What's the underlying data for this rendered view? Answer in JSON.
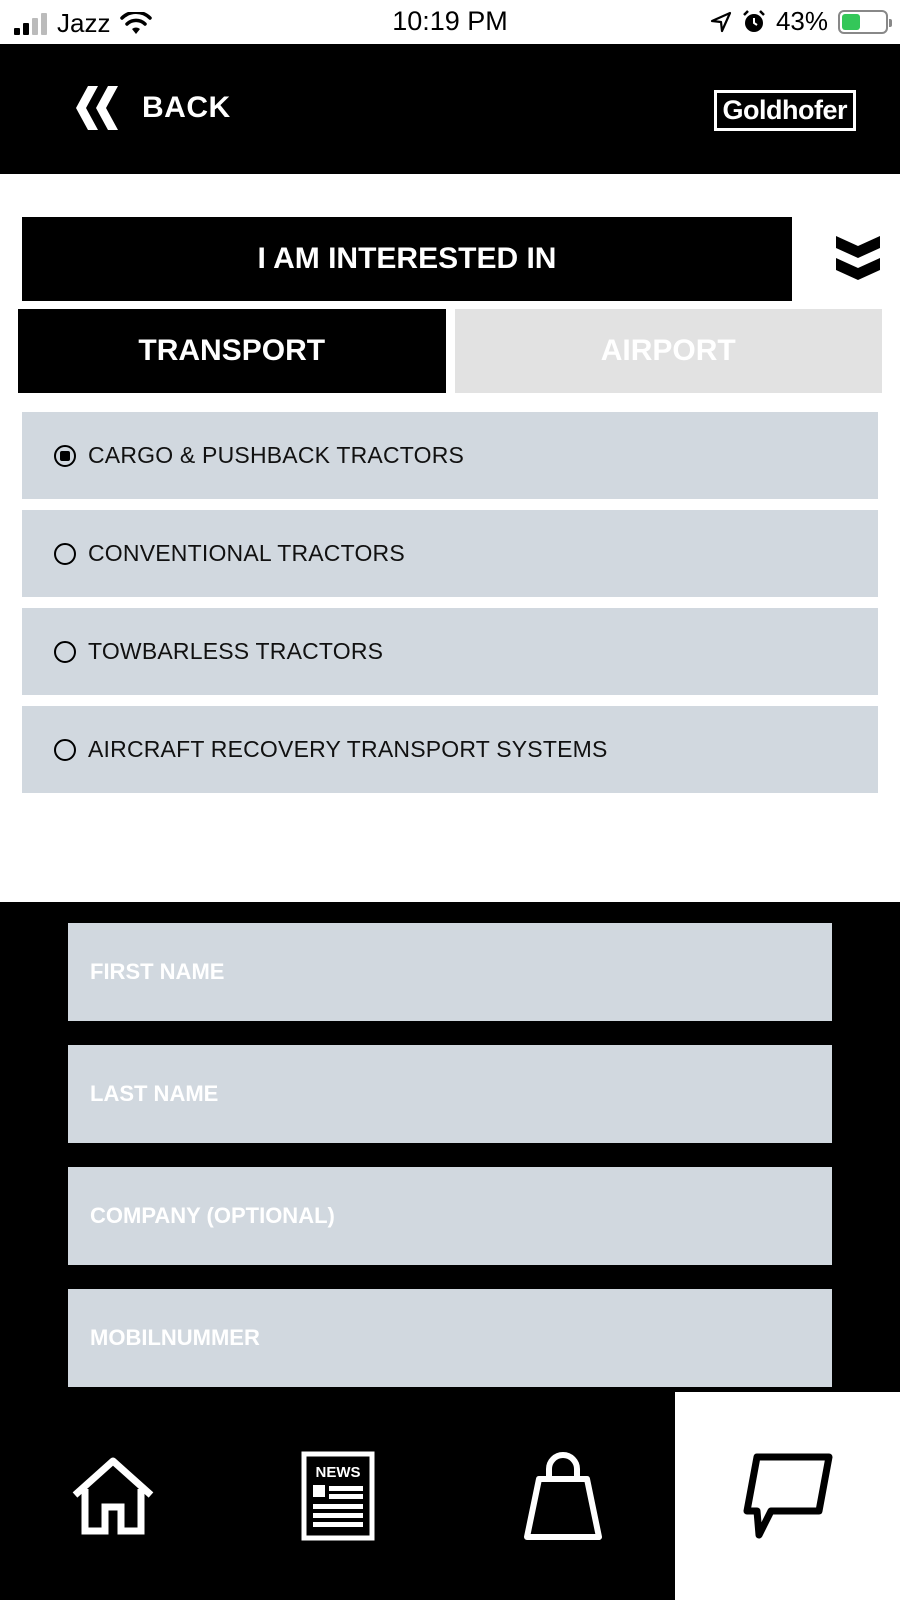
{
  "status_bar": {
    "carrier": "Jazz",
    "time": "10:19 PM",
    "battery_percent": "43%",
    "battery_level": 0.43,
    "battery_color": "#34c759"
  },
  "header": {
    "back_label": "BACK",
    "logo_text": "Goldhofer",
    "back_icon": "double-chevron-left-icon"
  },
  "interested": {
    "title": "I AM INTERESTED IN",
    "toggle_icon": "double-chevron-down-icon"
  },
  "tabs": [
    {
      "label": "TRANSPORT",
      "active": true
    },
    {
      "label": "AIRPORT",
      "active": false
    }
  ],
  "options": [
    {
      "label": "CARGO & PUSHBACK TRACTORS",
      "selected": true
    },
    {
      "label": "CONVENTIONAL TRACTORS",
      "selected": false
    },
    {
      "label": "TOWBARLESS TRACTORS",
      "selected": false
    },
    {
      "label": "AIRCRAFT RECOVERY TRANSPORT SYSTEMS",
      "selected": false
    }
  ],
  "form": {
    "first_name_placeholder": "FIRST NAME",
    "last_name_placeholder": "LAST NAME",
    "company_placeholder": "COMPANY (OPTIONAL)",
    "mobile_placeholder": "MOBILNUMMER"
  },
  "bottom_nav": {
    "items": [
      {
        "icon": "home-icon",
        "active": false
      },
      {
        "icon": "news-icon",
        "label": "NEWS",
        "active": false
      },
      {
        "icon": "shopping-bag-icon",
        "active": false
      },
      {
        "icon": "chat-icon",
        "active": true
      }
    ]
  },
  "colors": {
    "primary": "#000000",
    "option_bg": "#d1d8df",
    "inactive_tab": "#e2e2e2"
  }
}
